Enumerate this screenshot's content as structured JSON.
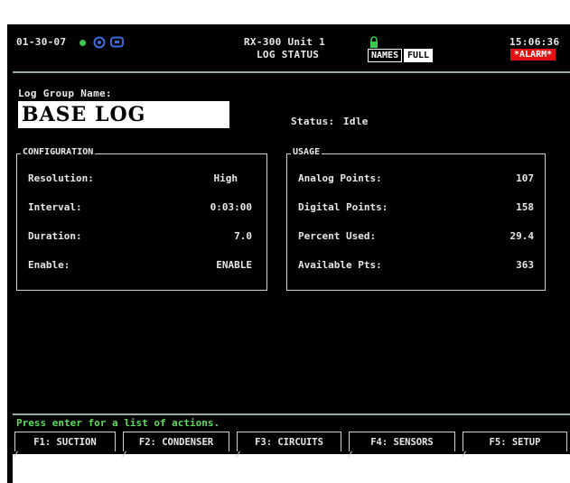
{
  "header": {
    "date": "01-30-07",
    "unit": "RX-300 Unit 1",
    "screen": "LOG STATUS",
    "time": "15:06:36",
    "names_pill": "NAMES",
    "full_pill": "FULL",
    "alarm": "*ALARM*",
    "status_dot_color": "#3cc84a",
    "lock_icon_color": "#3cc84a"
  },
  "log": {
    "label": "Log Group Name:",
    "name": "BASE LOG",
    "status_label": "Status:",
    "status_value": "Idle"
  },
  "configuration": {
    "title": "CONFIGURATION",
    "rows": [
      {
        "label": "Resolution:",
        "value": "High"
      },
      {
        "label": "Interval:",
        "value": "0:03:00"
      },
      {
        "label": "Duration:",
        "value": "7.0"
      },
      {
        "label": "Enable:",
        "value": "ENABLE"
      }
    ]
  },
  "usage": {
    "title": "USAGE",
    "rows": [
      {
        "label": "Analog Points:",
        "value": "107"
      },
      {
        "label": "Digital Points:",
        "value": "158"
      },
      {
        "label": "Percent Used:",
        "value": "29.4"
      },
      {
        "label": "Available Pts:",
        "value": "363"
      }
    ]
  },
  "prompt": "Press enter for a list of actions.",
  "fkeys": [
    {
      "label": "F1: SUCTION"
    },
    {
      "label": "F2: CONDENSER"
    },
    {
      "label": "F3: CIRCUITS"
    },
    {
      "label": "F4: SENSORS"
    },
    {
      "label": "F5: SETUP"
    }
  ]
}
